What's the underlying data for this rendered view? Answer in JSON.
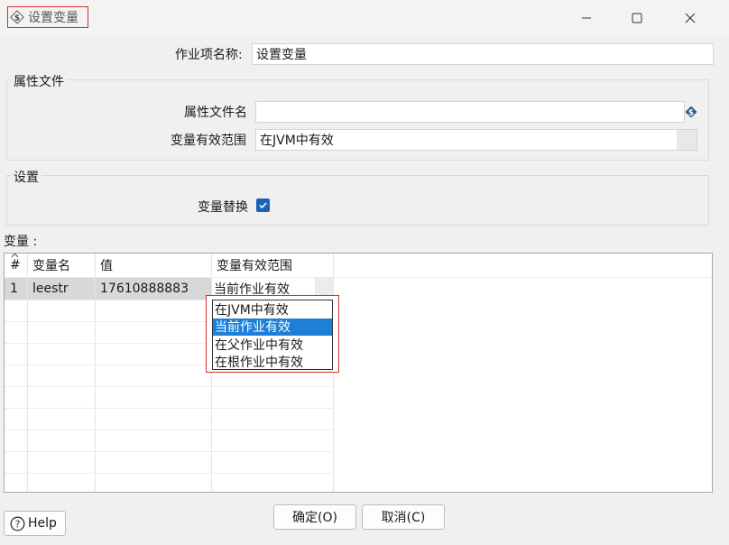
{
  "window": {
    "title": "设置变量"
  },
  "job_entry": {
    "label": "作业项名称:",
    "value": "设置变量"
  },
  "property_file": {
    "group_title": "属性文件",
    "filename_label": "属性文件名",
    "filename_value": "",
    "scope_label": "变量有效范围",
    "scope_value": "在JVM中有效"
  },
  "settings": {
    "group_title": "设置",
    "replace_label": "变量替换",
    "replace_checked": true
  },
  "variables": {
    "label": "变量 :",
    "columns": [
      "#",
      "变量名",
      "值",
      "变量有效范围"
    ],
    "rows": [
      {
        "index": "1",
        "name": "leestr",
        "value": "17610888883",
        "scope": "当前作业有效"
      }
    ],
    "dropdown_options": [
      "在JVM中有效",
      "当前作业有效",
      "在父作业中有效",
      "在根作业中有效"
    ],
    "dropdown_selected": "当前作业有效"
  },
  "buttons": {
    "ok": "确定(O)",
    "cancel": "取消(C)",
    "help": "Help"
  },
  "colors": {
    "accent": "#1e7fd9",
    "highlight_border": "#d9302b",
    "checkbox": "#1a64b5"
  },
  "icons": [
    "dollar-variable-icon",
    "minimize-icon",
    "maximize-icon",
    "close-icon",
    "variable-insert-icon",
    "sort-icon",
    "help-icon",
    "checkmark-icon"
  ]
}
